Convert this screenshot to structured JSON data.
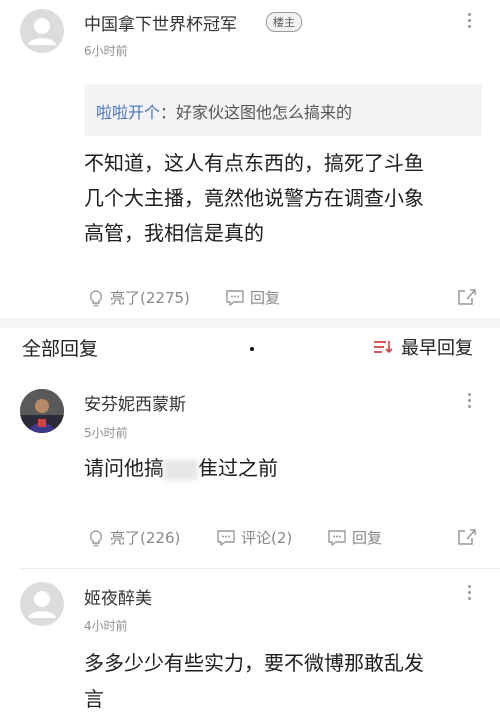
{
  "post": {
    "author": "中国拿下世界杯冠军",
    "badge": "楼主",
    "time": "6小时前",
    "quote_name": "啦啦开个",
    "quote_sep": "：",
    "quote_text": "好家伙这图他怎么搞来的",
    "body_lines": [
      "不知道，这人有点东西的，搞死了斗鱼",
      "几个大主播，竟然他说警方在调查小象",
      "高管，我相信是真的"
    ],
    "like_label": "亮了(2275)",
    "reply_label": "回复"
  },
  "section": {
    "title": "全部回复",
    "sort_label": "最早回复"
  },
  "comments": [
    {
      "author": "安芬妮西蒙斯",
      "time": "5小时前",
      "text_before": "请问他搞",
      "text_after": "隹过之前",
      "like_label": "亮了(226)",
      "comment_label": "评论(2)",
      "reply_label": "回复"
    },
    {
      "author": "姬夜醉美",
      "time": "4小时前",
      "body_lines": [
        "多多少少有些实力，要不微博那敢乱发",
        "言"
      ]
    }
  ],
  "icons": {
    "avatar_placeholder": "person-icon",
    "like": "lightbulb-icon",
    "reply": "chat-bubble-icon",
    "share": "share-icon",
    "more": "kebab-icon",
    "sort": "sort-icon"
  },
  "colors": {
    "quote_name": "#4a72b8",
    "sort_icon": "#d94040",
    "muted": "#8f8f8f"
  }
}
